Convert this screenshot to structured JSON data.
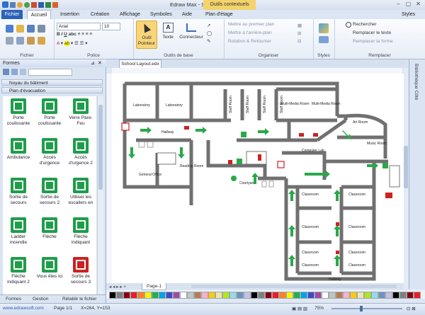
{
  "window": {
    "title": "Edraw Max - School Layout.edx",
    "context_tab": "Outils contextuels"
  },
  "tabs": [
    "Fichier",
    "Accueil",
    "Insertion",
    "Création",
    "Affichage",
    "Symboles",
    "Aide",
    "Plan d'étage"
  ],
  "tabs_right": "Styles",
  "ribbon": {
    "font_name": "Arial",
    "font_size": "10",
    "groups": [
      "Fichier",
      "Police",
      "Outils de base",
      "Organiser",
      "Styles",
      "Remplacer"
    ],
    "tool_pointer_line1": "Outil",
    "tool_pointer_line2": "Pointeur",
    "tool_text": "Texte",
    "tool_connector": "Connecteur",
    "arrange": [
      "Mettre au premier plan",
      "Mettre à l'arrière-plan",
      "Rotation & Retourner"
    ],
    "replace": [
      "Rechercher",
      "Remplacer le texte",
      "Remplacer la forme"
    ]
  },
  "shapes_panel": {
    "title": "Formes",
    "libraries": [
      "Noyau du bâtiment",
      "Plan d'évacuation"
    ],
    "items": [
      {
        "label": "Porte coulissante",
        "color": "#1e9e4a"
      },
      {
        "label": "Porte coulissante",
        "color": "#1e9e4a"
      },
      {
        "label": "Verre Pare-Feu",
        "color": "#1e9e4a"
      },
      {
        "label": "Ambulance",
        "color": "#1e9e4a"
      },
      {
        "label": "Accès d'urgence",
        "color": "#1e9e4a"
      },
      {
        "label": "Accès d'urgence 2",
        "color": "#1e9e4a"
      },
      {
        "label": "Sortie de secours",
        "color": "#1e9e4a"
      },
      {
        "label": "Sortie de secours 2",
        "color": "#1e9e4a"
      },
      {
        "label": "Utiliser les escaliers en",
        "color": "#1e9e4a"
      },
      {
        "label": "Ladder incendie",
        "color": "#1e9e4a"
      },
      {
        "label": "Flèche",
        "color": "#1e9e4a"
      },
      {
        "label": "Flèche indiquant",
        "color": "#1e9e4a"
      },
      {
        "label": "Flèche indiquant 2",
        "color": "#1e9e4a"
      },
      {
        "label": "Vous êtes ici",
        "color": "#1e9e4a"
      },
      {
        "label": "Sortie de secours 3",
        "color": "#cc2222"
      }
    ],
    "bottom_tabs": [
      "Formes",
      "Gestion",
      "Rétablir le fichier"
    ]
  },
  "document": {
    "tab": "School Layout.edx",
    "page_tab": "Page-1",
    "right_panel": "Bibliothèque Côté",
    "rooms": [
      "Laboratory",
      "Laboratory",
      "Staff Room",
      "Staff Room",
      "Staff Room",
      "Staff Room",
      "Multi-Media Room",
      "Multi-Media Room",
      "Art Room",
      "Music Room",
      "Hallway",
      "Computer Lab",
      "General Office",
      "Reading Room",
      "Courtyard",
      "Classroom",
      "Classroom",
      "Classroom",
      "Classroom",
      "Classroom",
      "Classroom",
      "Classroom",
      "Classroom",
      "Hallway"
    ]
  },
  "status": {
    "site": "www.edrawsoft.com",
    "page": "Page 1/1",
    "coords": "X=264, Y=153",
    "zoom": "75%"
  }
}
